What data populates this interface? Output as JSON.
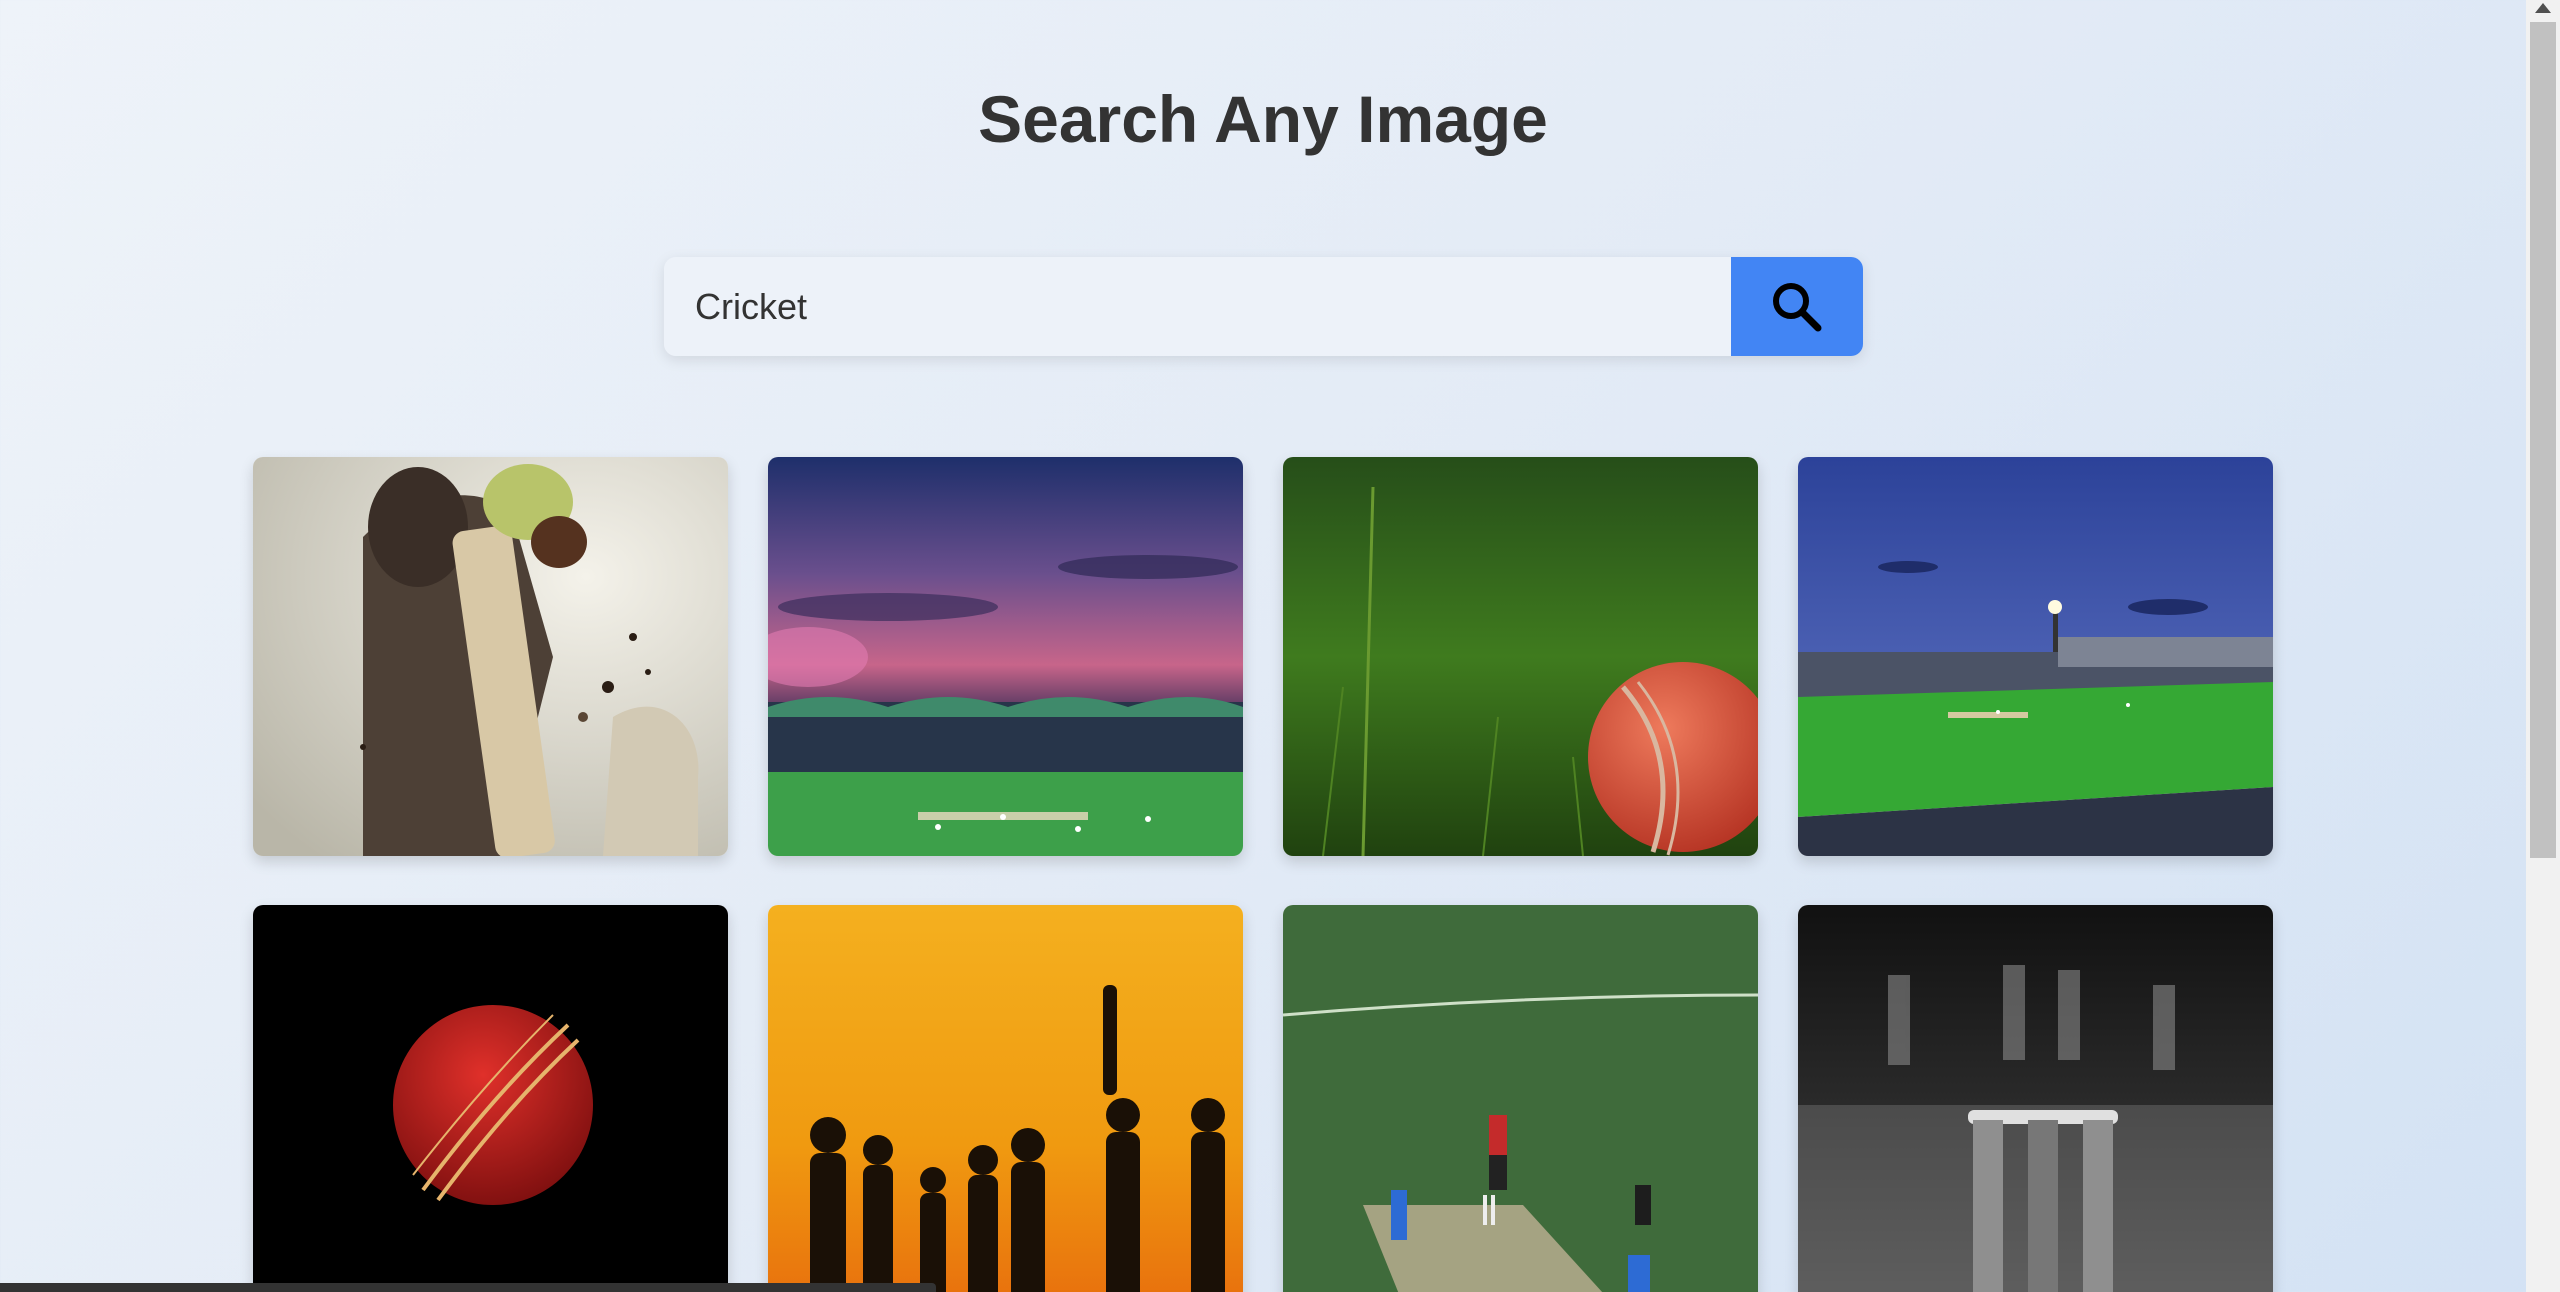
{
  "page": {
    "title": "Search Any Image"
  },
  "search": {
    "value": "Cricket",
    "button_icon": "search-icon",
    "accent_color": "#4285f4"
  },
  "results": [
    {
      "subject": "batsman-hitting-ball"
    },
    {
      "subject": "stadium-at-sunset"
    },
    {
      "subject": "ball-on-grass"
    },
    {
      "subject": "floodlit-stadium-night"
    },
    {
      "subject": "red-ball-black-background"
    },
    {
      "subject": "silhouettes-at-sunset"
    },
    {
      "subject": "players-on-pitch"
    },
    {
      "subject": "stumps-black-and-white"
    }
  ]
}
